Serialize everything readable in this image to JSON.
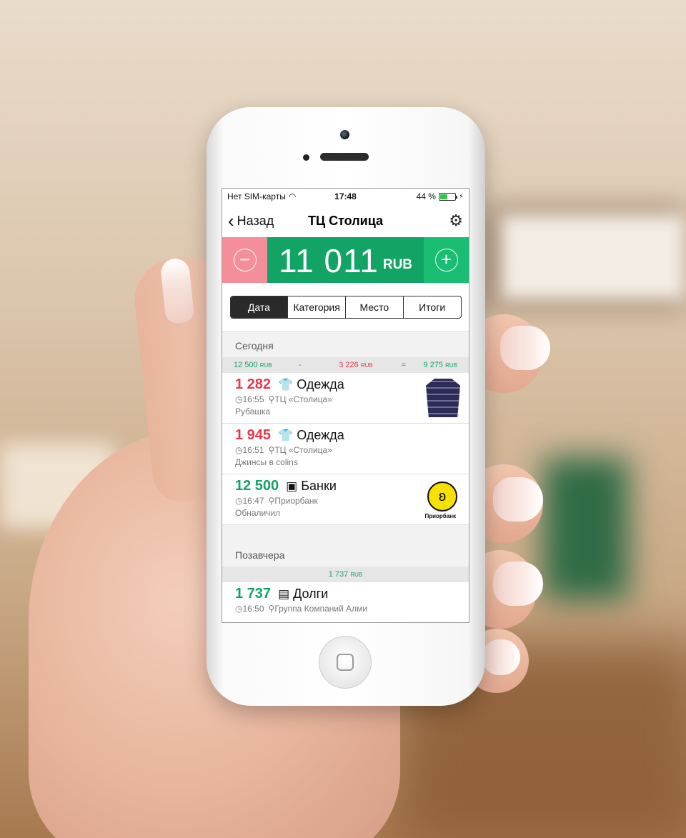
{
  "status": {
    "carrier": "Нет SIM-карты",
    "time": "17:48",
    "battery": "44 %"
  },
  "nav": {
    "back_label": "Назад",
    "title": "ТЦ Столица"
  },
  "balance": {
    "amount": "11 011",
    "currency": "RUB"
  },
  "tabs": [
    {
      "label": "Дата",
      "active": true
    },
    {
      "label": "Категория",
      "active": false
    },
    {
      "label": "Место",
      "active": false
    },
    {
      "label": "Итоги",
      "active": false
    }
  ],
  "groups": [
    {
      "title": "Сегодня",
      "summary": {
        "income": "12 500",
        "income_cur": "RUB",
        "minus": "-",
        "expense": "3 226",
        "expense_cur": "RUB",
        "equals": "=",
        "total": "9 275",
        "total_cur": "RUB"
      },
      "items": [
        {
          "amount": "1 282",
          "category": "Одежда",
          "time": "16:55",
          "place": "ТЦ «Столица»",
          "note": "Рубашка"
        },
        {
          "amount": "1 945",
          "category": "Одежда",
          "time": "16:51",
          "place": "ТЦ «Столица»",
          "note": "Джинсы в colins"
        },
        {
          "amount": "12 500",
          "category": "Банки",
          "time": "16:47",
          "place": "Приорбанк",
          "note": "Обналичил",
          "logo_text": "Приорбанк"
        }
      ]
    },
    {
      "title": "Позавчера",
      "summary": {
        "total": "1 737",
        "total_cur": "RUB"
      },
      "items": [
        {
          "amount": "1 737",
          "category": "Долги",
          "time": "16:50",
          "place": "Группа Компаний Алми"
        }
      ]
    }
  ],
  "colors": {
    "expense": "#e23a4a",
    "income": "#12a464",
    "minus_bg": "#f38e9a",
    "plus_bg": "#19be74",
    "balance_bg": "#12a464"
  }
}
